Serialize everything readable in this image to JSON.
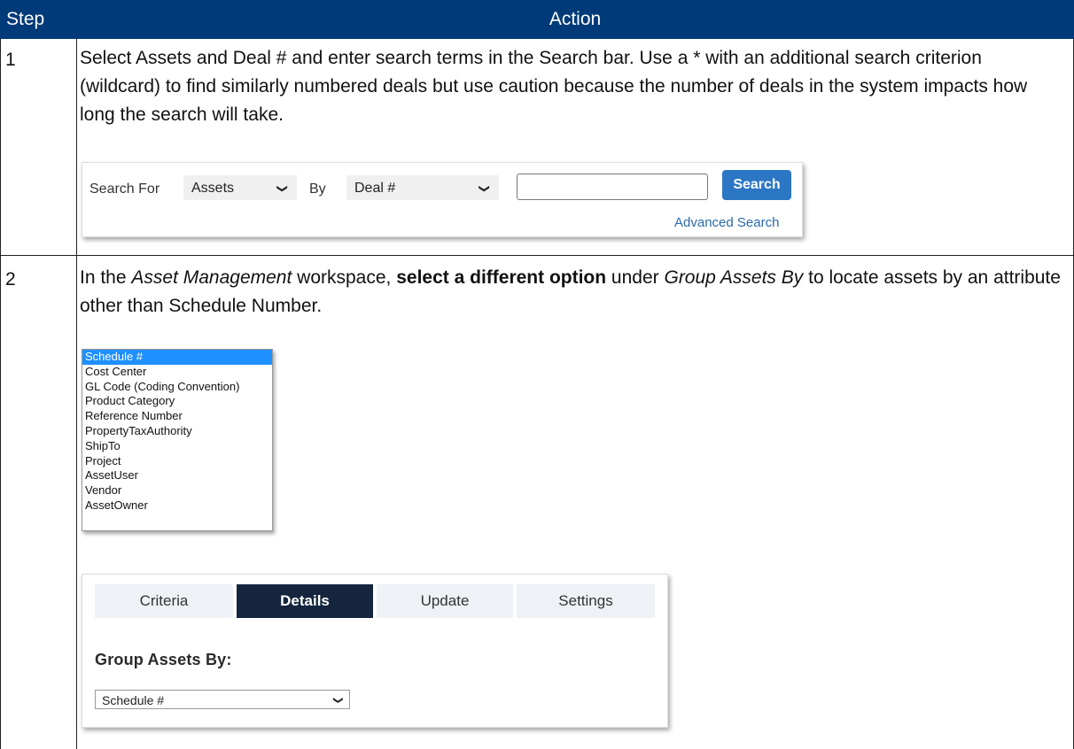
{
  "table": {
    "header_step": "Step",
    "header_action": "Action"
  },
  "rows": [
    {
      "step": "1",
      "text": "Select Assets and Deal # and enter search terms in the Search bar. Use a * with an additional search criterion (wildcard) to find similarly numbered deals but use caution because the number of deals in the system impacts how long the search will take."
    },
    {
      "step": "2",
      "text_parts": [
        "In the ",
        "Asset Management",
        " workspace, ",
        "select a different option",
        " under ",
        "Group Assets By",
        " to locate assets by an attribute other than Schedule Number."
      ]
    }
  ],
  "search_widget": {
    "search_for_label": "Search For",
    "search_for_value": "Assets",
    "by_label": "By",
    "by_value": "Deal #",
    "input_value": "",
    "search_button": "Search",
    "advanced_link": "Advanced Search"
  },
  "group_options": [
    "Schedule #",
    "Cost Center",
    "GL Code (Coding Convention)",
    "Product Category",
    "Reference Number",
    "PropertyTaxAuthority",
    "ShipTo",
    "Project",
    "AssetUser",
    "Vendor",
    "AssetOwner"
  ],
  "selected_option": "Schedule #",
  "panel": {
    "tabs": [
      "Criteria",
      "Details",
      "Update",
      "Settings"
    ],
    "active_tab": "Details",
    "group_label": "Group Assets By:",
    "group_value": "Schedule #"
  },
  "colors": {
    "header_bg": "#003a78",
    "search_button": "#2b77c4",
    "selected_item": "#1e90ff",
    "active_tab": "#14253d"
  },
  "icons": {
    "dropdown": "chevron-down-icon"
  }
}
